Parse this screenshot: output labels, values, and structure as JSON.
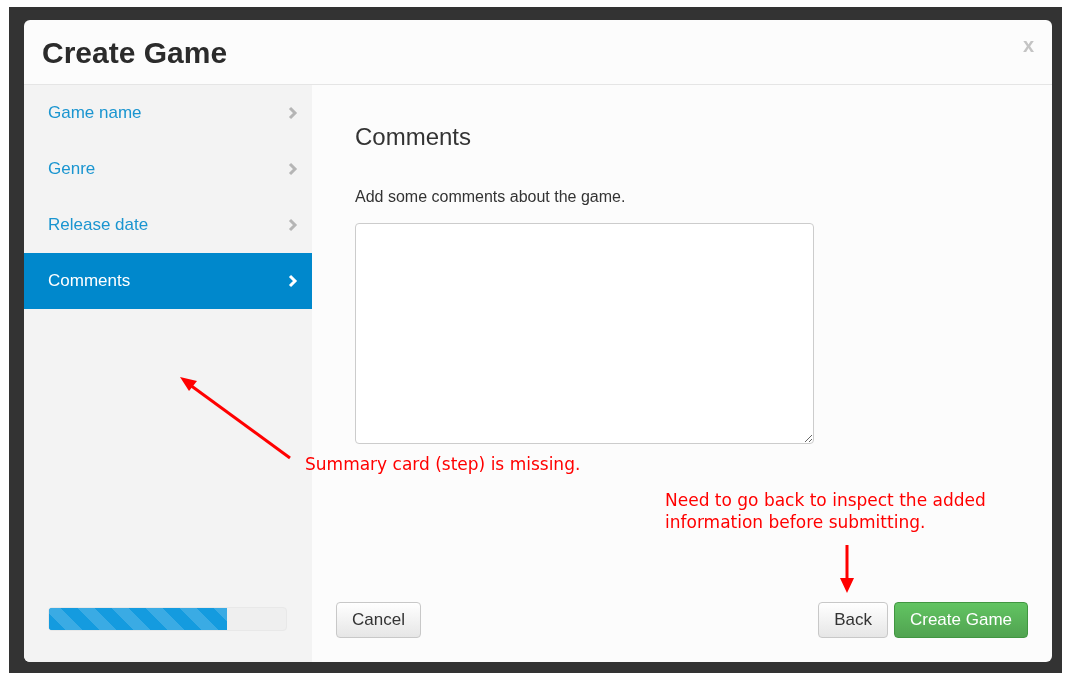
{
  "dialog": {
    "title": "Create Game",
    "close": "x"
  },
  "steps": [
    {
      "label": "Game name",
      "selected": false
    },
    {
      "label": "Genre",
      "selected": false
    },
    {
      "label": "Release date",
      "selected": false
    },
    {
      "label": "Comments",
      "selected": true
    }
  ],
  "progress": {
    "level": 0.75
  },
  "content": {
    "heading": "Comments",
    "label": "Add some comments about the game."
  },
  "buttons": {
    "cancel": "Cancel",
    "back": "Back",
    "submit": "Create Game"
  },
  "annotations": [
    {
      "text": "Summary card (step) is missing."
    },
    {
      "text": "Need to go back to inspect the added information before submitting."
    }
  ]
}
